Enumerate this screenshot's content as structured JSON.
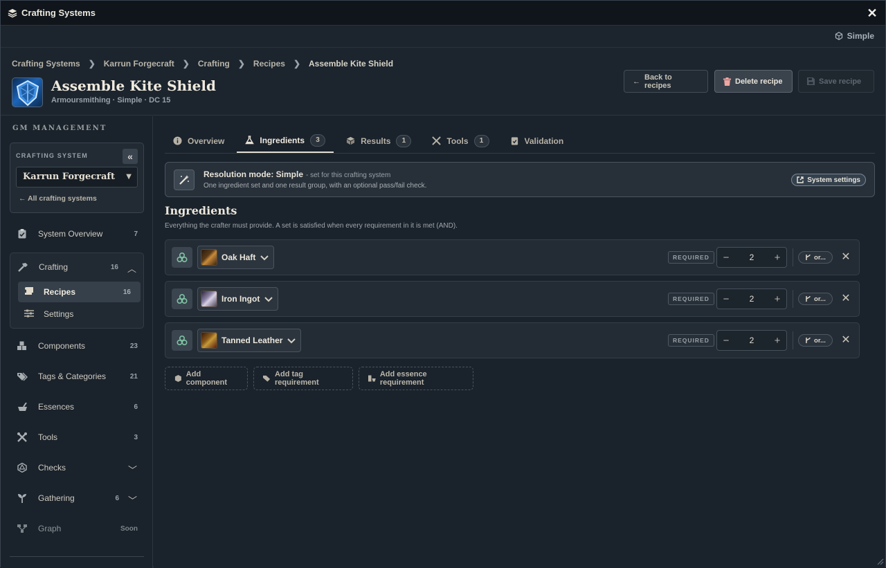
{
  "window": {
    "title": "Crafting Systems",
    "mode": "Simple"
  },
  "breadcrumb": [
    "Crafting Systems",
    "Karrun Forgecraft",
    "Crafting",
    "Recipes",
    "Assemble Kite Shield"
  ],
  "recipe": {
    "title": "Assemble Kite Shield",
    "subtitle": "Armoursmithing · Simple · DC 15"
  },
  "actions": {
    "back": "Back to recipes",
    "delete": "Delete recipe",
    "save": "Save recipe"
  },
  "sidebar": {
    "heading": "GM MANAGEMENT",
    "system_label": "CRAFTING SYSTEM",
    "system_value": "Karrun Forgecraft",
    "all_link": "All crafting systems",
    "items": [
      {
        "label": "System Overview",
        "count": "7",
        "icon": "clipboard-icon"
      },
      {
        "label": "Crafting",
        "count": "16",
        "icon": "hammer-icon"
      },
      {
        "label": "Components",
        "count": "23",
        "icon": "boxes-icon"
      },
      {
        "label": "Tags & Categories",
        "count": "21",
        "icon": "tags-icon"
      },
      {
        "label": "Essences",
        "count": "6",
        "icon": "mortar-icon"
      },
      {
        "label": "Tools",
        "count": "3",
        "icon": "tools-icon"
      },
      {
        "label": "Checks",
        "count": "",
        "icon": "d20-icon"
      },
      {
        "label": "Gathering",
        "count": "6",
        "icon": "sprout-icon"
      },
      {
        "label": "Graph",
        "count": "Soon",
        "icon": "graph-icon"
      }
    ],
    "sub_items": [
      {
        "label": "Recipes",
        "count": "16"
      },
      {
        "label": "Settings",
        "count": ""
      }
    ]
  },
  "tabs": [
    {
      "label": "Overview",
      "badge": ""
    },
    {
      "label": "Ingredients",
      "badge": "3"
    },
    {
      "label": "Results",
      "badge": "1"
    },
    {
      "label": "Tools",
      "badge": "1"
    },
    {
      "label": "Validation",
      "badge": ""
    }
  ],
  "resolution": {
    "title": "Resolution mode: Simple",
    "note": "- set for this crafting system",
    "desc": "One ingredient set and one result group, with an optional pass/fail check.",
    "button": "System settings"
  },
  "ingredients": {
    "title": "Ingredients",
    "desc": "Everything the crafter must provide. A set is satisfied when every requirement in it is met (AND).",
    "rows": [
      {
        "name": "Oak Haft",
        "badge": "REQUIRED",
        "qty": "2",
        "or": "or..."
      },
      {
        "name": "Iron Ingot",
        "badge": "REQUIRED",
        "qty": "2",
        "or": "or..."
      },
      {
        "name": "Tanned Leather",
        "badge": "REQUIRED",
        "qty": "2",
        "or": "or..."
      }
    ],
    "add_component": "Add component",
    "add_tag": "Add tag requirement",
    "add_essence": "Add essence requirement"
  },
  "colors": {
    "accent": "#7fc4a4",
    "background": "#1a222b",
    "panel": "#232c35"
  }
}
